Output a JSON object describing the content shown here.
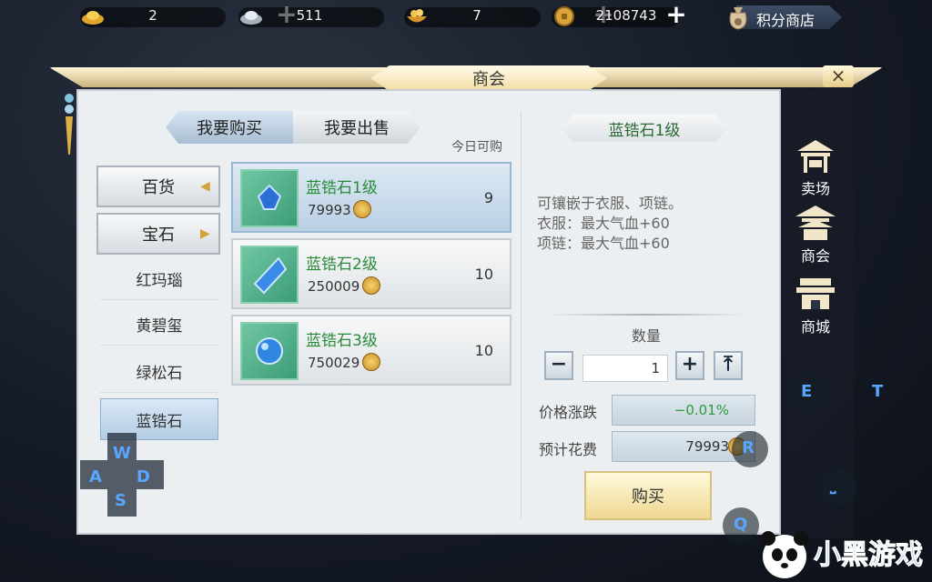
{
  "currency": [
    {
      "icon": "gold-ingot-icon",
      "value": "2"
    },
    {
      "icon": "silver-ingot-icon",
      "value": "511"
    },
    {
      "icon": "treasure-bowl-icon",
      "value": "7"
    },
    {
      "icon": "copper-coin-icon",
      "value": "2108743"
    }
  ],
  "shop_button": {
    "label": "积分商店"
  },
  "window": {
    "title": "商会",
    "close_label": "×"
  },
  "tabs": {
    "buy": "我要购买",
    "sell": "我要出售"
  },
  "list_header": {
    "today_buyable": "今日可购"
  },
  "categories": [
    {
      "label": "百货",
      "expanded": false
    },
    {
      "label": "宝石",
      "expanded": true
    }
  ],
  "subcategories": [
    "红玛瑙",
    "黄碧玺",
    "绿松石",
    "蓝锆石"
  ],
  "items": [
    {
      "name": "蓝锆石1级",
      "price": "79993",
      "qty": "9",
      "selected": true
    },
    {
      "name": "蓝锆石2级",
      "price": "250009",
      "qty": "10",
      "selected": false
    },
    {
      "name": "蓝锆石3级",
      "price": "750029",
      "qty": "10",
      "selected": false
    }
  ],
  "detail": {
    "title": "蓝锆石1级",
    "desc": [
      "可镶嵌于衣服、项链。",
      "衣服：最大气血+60",
      "项链：最大气血+60"
    ],
    "quantity_label": "数量",
    "quantity": "1",
    "minus": "−",
    "plus": "+",
    "max": "⤒",
    "price_change_label": "价格涨跌",
    "price_change": "−0.01%",
    "cost_label": "预计花费",
    "cost": "79993",
    "buy_label": "购买"
  },
  "side_nav": [
    {
      "label": "卖场",
      "icon": "market-stall-icon"
    },
    {
      "label": "商会",
      "icon": "pavilion-icon"
    },
    {
      "label": "商城",
      "icon": "shop-building-icon"
    }
  ],
  "keys": {
    "w": "W",
    "a": "A",
    "s": "S",
    "d": "D",
    "e": "E",
    "t": "T",
    "r": "R",
    "q": "Q",
    "space": "⎵"
  },
  "logo_text": "小黑游戏",
  "colors": {
    "accent_green": "#2a8a3a",
    "price_change_green": "#2c9a3c",
    "key_blue": "#58a6ff"
  }
}
